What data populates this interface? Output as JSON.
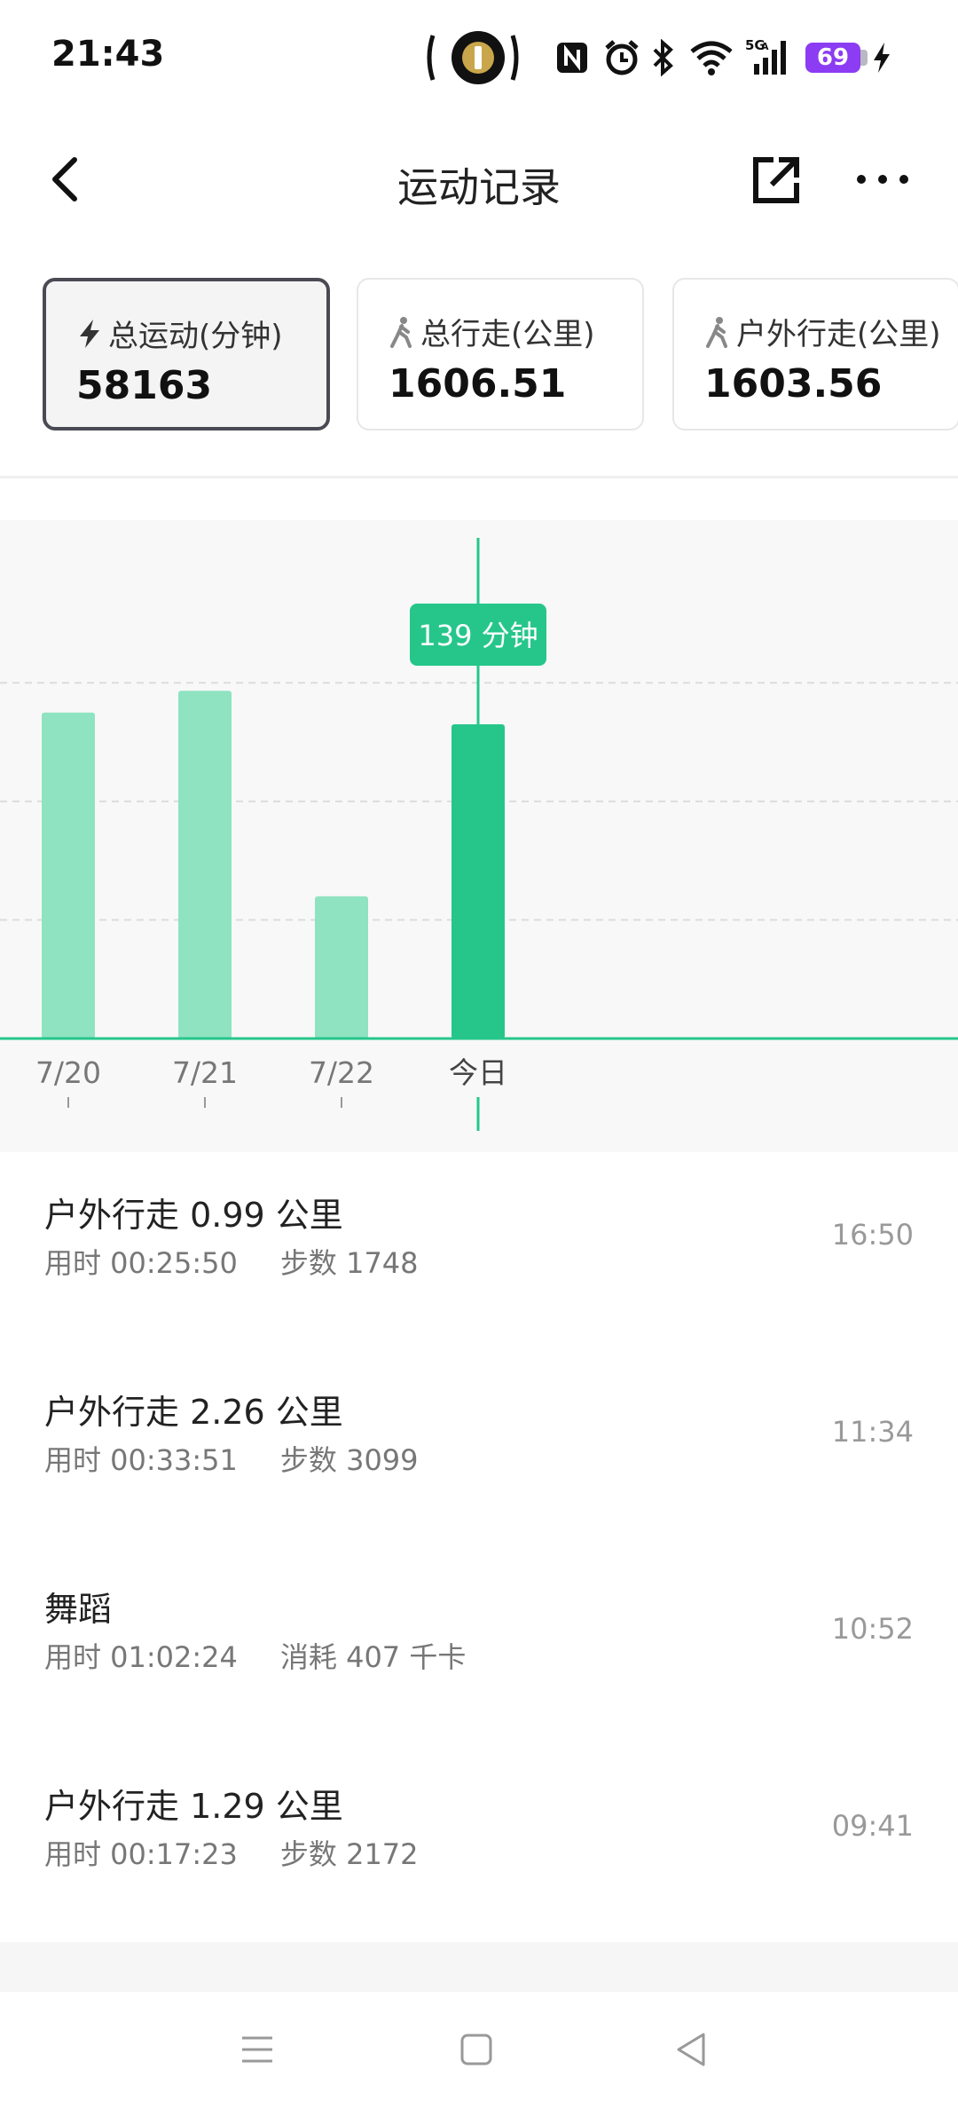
{
  "status_bar": {
    "time": "21:43",
    "battery_level": "69",
    "icons": [
      "flashlight-icon",
      "nfc-icon",
      "alarm-icon",
      "bluetooth-icon",
      "wifi-icon",
      "cellular-5g-icon",
      "battery-icon",
      "charging-icon"
    ]
  },
  "header": {
    "title": "运动记录",
    "back_icon": "chevron-left-icon",
    "share_icon": "share-external-icon",
    "more_icon": "more-horizontal-icon"
  },
  "summary_cards": [
    {
      "label": "总运动(分钟)",
      "value": "58163",
      "icon": "lightning-icon",
      "active": true
    },
    {
      "label": "总行走(公里)",
      "value": "1606.51",
      "icon": "walk-icon",
      "active": false
    },
    {
      "label": "户外行走(公里)",
      "value": "1603.56",
      "icon": "walk-icon",
      "active": false
    }
  ],
  "chart_data": {
    "type": "bar",
    "categories": [
      "7/20",
      "7/21",
      "7/22",
      "今日"
    ],
    "values": [
      165,
      176,
      72,
      159
    ],
    "selected_index": 3,
    "selected_label": "139 分钟",
    "grid": true,
    "gridlines": [
      60,
      120,
      180
    ],
    "ylim": [
      0,
      230
    ],
    "colors": {
      "bar": "#8fe3c1",
      "bar_selected": "#26c68b",
      "axis": "#26c68b"
    }
  },
  "records": [
    {
      "title": "户外行走 0.99 公里",
      "duration": "用时 00:25:50",
      "metric": "步数 1748",
      "time": "16:50"
    },
    {
      "title": "户外行走 2.26 公里",
      "duration": "用时 00:33:51",
      "metric": "步数 3099",
      "time": "11:34"
    },
    {
      "title": "舞蹈",
      "duration": "用时 01:02:24",
      "metric": "消耗 407 千卡",
      "time": "10:52"
    },
    {
      "title": "户外行走 1.29 公里",
      "duration": "用时 00:17:23",
      "metric": "步数 2172",
      "time": "09:41"
    }
  ],
  "nav_bar": {
    "icons": [
      "menu-icon",
      "home-square-icon",
      "back-triangle-icon"
    ]
  }
}
